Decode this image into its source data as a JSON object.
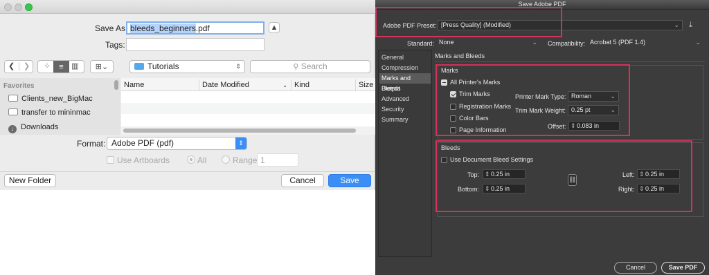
{
  "save_dialog": {
    "save_as_label": "Save As:",
    "filename": "bleeds_beginners.pdf",
    "filename_selected": "bleeds_beginners",
    "filename_rest": ".pdf",
    "tags_label": "Tags:",
    "location": "Tutorials",
    "search_placeholder": "Search",
    "sidebar_heading": "Favorites",
    "sidebar_items": [
      "Clients_new_BigMac",
      "transfer to mininmac",
      "Downloads"
    ],
    "columns": [
      "Name",
      "Date Modified",
      "Kind",
      "Size"
    ],
    "format_label": "Format:",
    "format_value": "Adobe PDF (pdf)",
    "use_artboards_label": "Use Artboards",
    "all_label": "All",
    "range_label": "Range:",
    "range_value": "1",
    "new_folder_label": "New Folder",
    "cancel_label": "Cancel",
    "save_label": "Save",
    "accent_color": "#3a8ef6"
  },
  "pdf_dialog": {
    "title": "Save Adobe PDF",
    "preset_label": "Adobe PDF Preset:",
    "preset_value": "[Press Quality] (Modified)",
    "standard_label": "Standard:",
    "standard_value": "None",
    "compatibility_label": "Compatibility:",
    "compatibility_value": "Acrobat 5 (PDF 1.4)",
    "nav_items": [
      "General",
      "Compression",
      "Marks and Bleeds",
      "Output",
      "Advanced",
      "Security",
      "Summary"
    ],
    "selected_nav": "Marks and Bleeds",
    "section_title": "Marks and Bleeds",
    "marks_heading": "Marks",
    "all_printers_marks": "All Printer's Marks",
    "trim_marks": "Trim Marks",
    "registration_marks": "Registration Marks",
    "color_bars": "Color Bars",
    "page_information": "Page Information",
    "printer_mark_type_label": "Printer Mark Type:",
    "printer_mark_type_value": "Roman",
    "trim_mark_weight_label": "Trim Mark Weight:",
    "trim_mark_weight_value": "0.25 pt",
    "offset_label": "Offset:",
    "offset_value": "0.083 in",
    "bleeds_heading": "Bleeds",
    "use_document_bleed": "Use Document Bleed Settings",
    "top_label": "Top:",
    "top_value": "0.25 in",
    "bottom_label": "Bottom:",
    "bottom_value": "0.25 in",
    "left_label": "Left:",
    "left_value": "0.25 in",
    "right_label": "Right:",
    "right_value": "0.25 in",
    "cancel_label": "Cancel",
    "save_pdf_label": "Save PDF",
    "highlight_color": "#d4315b"
  }
}
